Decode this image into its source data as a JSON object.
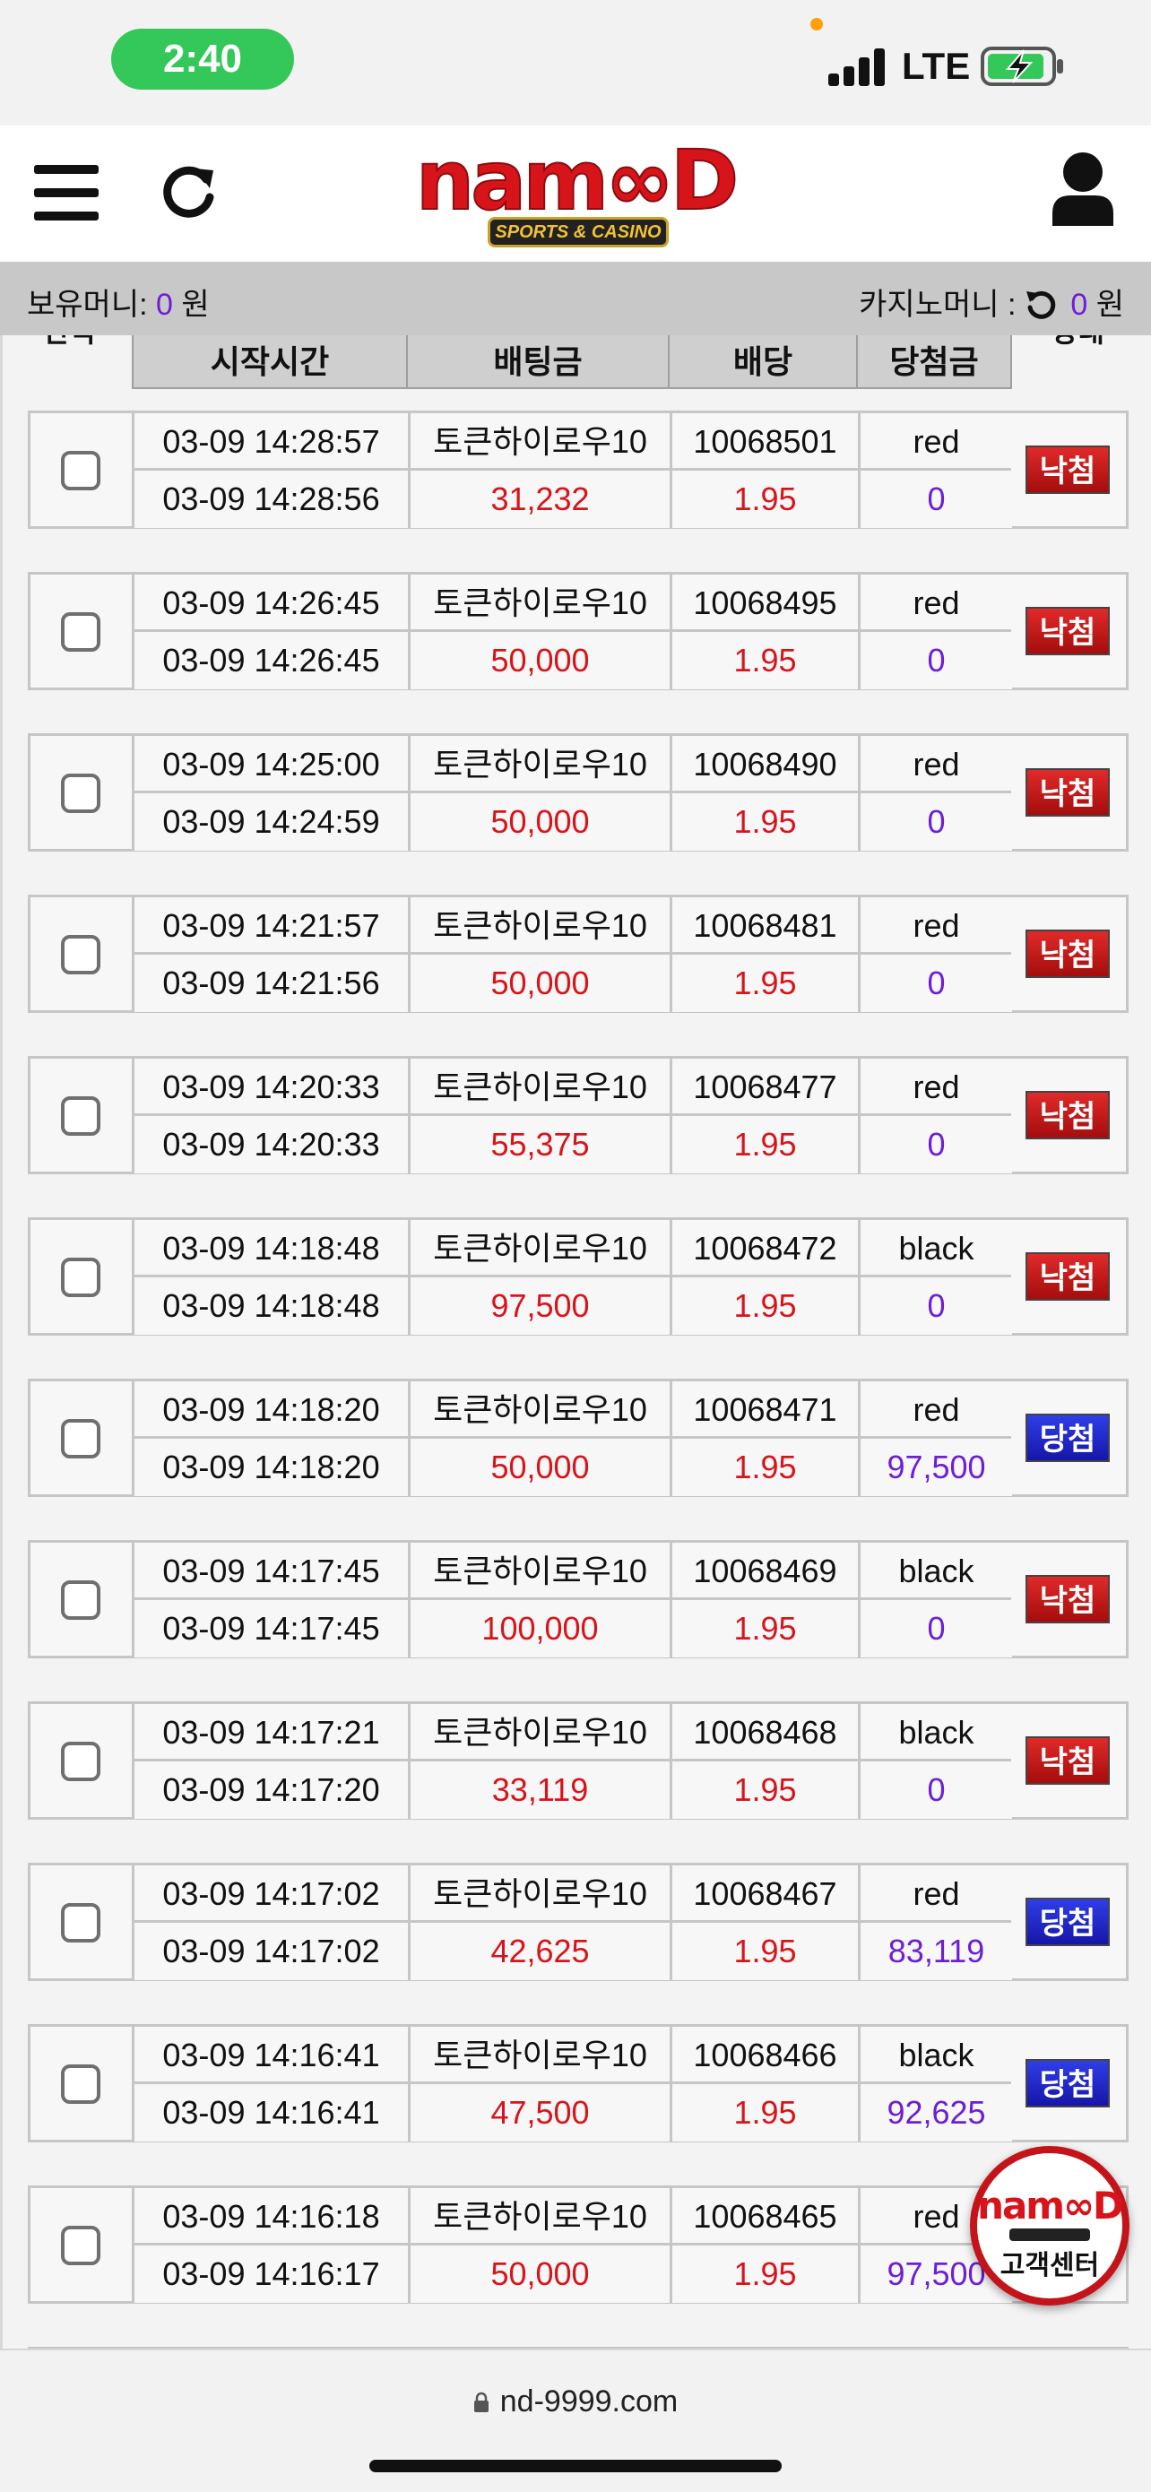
{
  "status_bar": {
    "time": "2:40",
    "network": "LTE"
  },
  "header": {
    "logo_text": "nam∞D",
    "logo_sub": "SPORTS & CASINO"
  },
  "money_bar": {
    "held_label": "보유머니:",
    "held_value": "0",
    "held_unit": "원",
    "casino_label": "카지노머니 :",
    "casino_value": "0",
    "casino_unit": "원"
  },
  "table": {
    "headers": {
      "select": "전택",
      "start_time": "시작시간",
      "bet_amount": "배팅금",
      "odds": "배당",
      "win_amount": "당첨금",
      "status": "상태"
    },
    "rows": [
      {
        "time1": "03-09 14:28:57",
        "time2": "03-09 14:28:56",
        "game": "토큰하이로우10",
        "amount": "31,232",
        "id": "10068501",
        "odds": "1.95",
        "pick": "red",
        "payout": "0",
        "status": "낙첨",
        "result": "lose"
      },
      {
        "time1": "03-09 14:26:45",
        "time2": "03-09 14:26:45",
        "game": "토큰하이로우10",
        "amount": "50,000",
        "id": "10068495",
        "odds": "1.95",
        "pick": "red",
        "payout": "0",
        "status": "낙첨",
        "result": "lose"
      },
      {
        "time1": "03-09 14:25:00",
        "time2": "03-09 14:24:59",
        "game": "토큰하이로우10",
        "amount": "50,000",
        "id": "10068490",
        "odds": "1.95",
        "pick": "red",
        "payout": "0",
        "status": "낙첨",
        "result": "lose"
      },
      {
        "time1": "03-09 14:21:57",
        "time2": "03-09 14:21:56",
        "game": "토큰하이로우10",
        "amount": "50,000",
        "id": "10068481",
        "odds": "1.95",
        "pick": "red",
        "payout": "0",
        "status": "낙첨",
        "result": "lose"
      },
      {
        "time1": "03-09 14:20:33",
        "time2": "03-09 14:20:33",
        "game": "토큰하이로우10",
        "amount": "55,375",
        "id": "10068477",
        "odds": "1.95",
        "pick": "red",
        "payout": "0",
        "status": "낙첨",
        "result": "lose"
      },
      {
        "time1": "03-09 14:18:48",
        "time2": "03-09 14:18:48",
        "game": "토큰하이로우10",
        "amount": "97,500",
        "id": "10068472",
        "odds": "1.95",
        "pick": "black",
        "payout": "0",
        "status": "낙첨",
        "result": "lose"
      },
      {
        "time1": "03-09 14:18:20",
        "time2": "03-09 14:18:20",
        "game": "토큰하이로우10",
        "amount": "50,000",
        "id": "10068471",
        "odds": "1.95",
        "pick": "red",
        "payout": "97,500",
        "status": "당첨",
        "result": "win"
      },
      {
        "time1": "03-09 14:17:45",
        "time2": "03-09 14:17:45",
        "game": "토큰하이로우10",
        "amount": "100,000",
        "id": "10068469",
        "odds": "1.95",
        "pick": "black",
        "payout": "0",
        "status": "낙첨",
        "result": "lose"
      },
      {
        "time1": "03-09 14:17:21",
        "time2": "03-09 14:17:20",
        "game": "토큰하이로우10",
        "amount": "33,119",
        "id": "10068468",
        "odds": "1.95",
        "pick": "black",
        "payout": "0",
        "status": "낙첨",
        "result": "lose"
      },
      {
        "time1": "03-09 14:17:02",
        "time2": "03-09 14:17:02",
        "game": "토큰하이로우10",
        "amount": "42,625",
        "id": "10068467",
        "odds": "1.95",
        "pick": "red",
        "payout": "83,119",
        "status": "당첨",
        "result": "win"
      },
      {
        "time1": "03-09 14:16:41",
        "time2": "03-09 14:16:41",
        "game": "토큰하이로우10",
        "amount": "47,500",
        "id": "10068466",
        "odds": "1.95",
        "pick": "black",
        "payout": "92,625",
        "status": "당첨",
        "result": "win"
      },
      {
        "time1": "03-09 14:16:18",
        "time2": "03-09 14:16:17",
        "game": "토큰하이로우10",
        "amount": "50,000",
        "id": "10068465",
        "odds": "1.95",
        "pick": "red",
        "payout": "97,500",
        "status": "",
        "result": "hidden"
      }
    ]
  },
  "customer_center": {
    "logo_text": "nam∞D",
    "label": "고객센터"
  },
  "browser": {
    "url": "nd-9999.com"
  },
  "colors": {
    "brand_red": "#d8141b",
    "payout_purple": "#6c1fd6",
    "lose_badge": "#c41a1a",
    "win_badge": "#2424c8",
    "time_pill": "#34c759"
  }
}
